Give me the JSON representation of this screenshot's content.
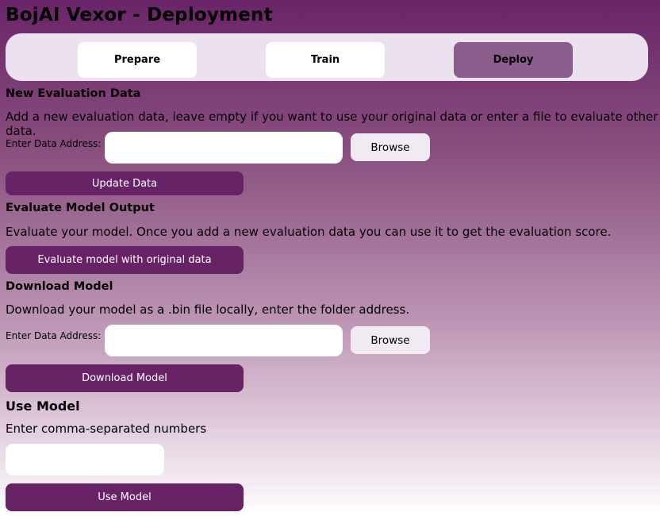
{
  "window": {
    "title": "BojAI Vexor - Deployment"
  },
  "tabs": [
    {
      "label": "Prepare",
      "active": false
    },
    {
      "label": "Train",
      "active": false
    },
    {
      "label": "Deploy",
      "active": true
    }
  ],
  "eval_data": {
    "heading": "New Evaluation Data",
    "description": "Add a new evaluation data, leave empty if you want to use your original data or enter a file to evaluate other data.",
    "field_label": "Enter Data Address:",
    "field_value": "",
    "browse_label": "Browse",
    "update_label": "Update Data"
  },
  "evaluate": {
    "heading": "Evaluate Model Output",
    "description": "Evaluate your model. Once you add a new evaluation data you can use it to get the evaluation score.",
    "button_label": "Evaluate model with original data"
  },
  "download": {
    "heading": "Download Model",
    "description": "Download your model as a .bin file locally, enter the folder address.",
    "field_label": "Enter Data Address:",
    "field_value": "",
    "browse_label": "Browse",
    "button_label": "Download Model"
  },
  "use_model": {
    "heading": "Use Model",
    "description": "Enter comma-separated numbers",
    "input_value": "",
    "button_label": "Use Model"
  },
  "colors": {
    "accent": "#682366",
    "active_tab": "#8c5c8c",
    "tab_bar": "#ece2ef",
    "browse_bg": "#f1eaf3"
  }
}
